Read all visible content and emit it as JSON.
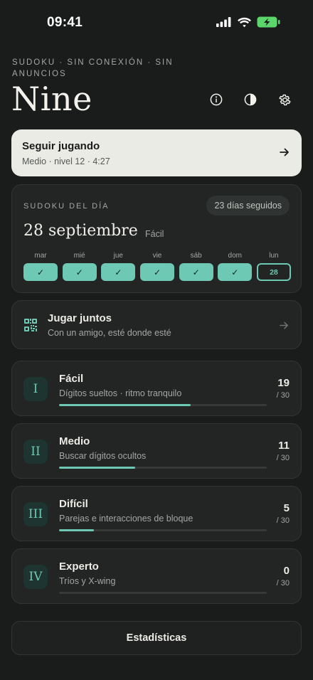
{
  "status": {
    "time": "09:41"
  },
  "header": {
    "kicker": "SUDOKU · SIN CONEXIÓN · SIN ANUNCIOS",
    "title": "Nine",
    "icons": [
      "info-icon",
      "contrast-icon",
      "gear-icon"
    ]
  },
  "continue": {
    "title": "Seguir jugando",
    "subtitle": "Medio · nivel 12 · 4:27"
  },
  "daily": {
    "label": "SUDOKU DEL DÍA",
    "streak": "23 días seguidos",
    "date": "28 septiembre",
    "difficulty": "Fácil",
    "days": [
      {
        "name": "mar",
        "mark": "✓"
      },
      {
        "name": "mié",
        "mark": "✓"
      },
      {
        "name": "jue",
        "mark": "✓"
      },
      {
        "name": "vie",
        "mark": "✓"
      },
      {
        "name": "sáb",
        "mark": "✓"
      },
      {
        "name": "dom",
        "mark": "✓"
      },
      {
        "name": "lun",
        "mark": "28"
      }
    ]
  },
  "together": {
    "title": "Jugar juntos",
    "subtitle": "Con un amigo, esté donde esté"
  },
  "levels": [
    {
      "roman": "I",
      "name": "Fácil",
      "desc": "Dígitos sueltos · ritmo tranquilo",
      "count": "19",
      "total": "/ 30",
      "progress": 0.633
    },
    {
      "roman": "II",
      "name": "Medio",
      "desc": "Buscar dígitos ocultos",
      "count": "11",
      "total": "/ 30",
      "progress": 0.367
    },
    {
      "roman": "III",
      "name": "Difícil",
      "desc": "Parejas e interacciones de bloque",
      "count": "5",
      "total": "/ 30",
      "progress": 0.167
    },
    {
      "roman": "IV",
      "name": "Experto",
      "desc": "Tríos y X-wing",
      "count": "0",
      "total": "/ 30",
      "progress": 0.0
    }
  ],
  "stats_button": {
    "label": "Estadísticas"
  },
  "colors": {
    "accent": "#6dc8b4",
    "background": "#1a1c1b",
    "card": "#222524",
    "battery": "#5bd66a"
  }
}
